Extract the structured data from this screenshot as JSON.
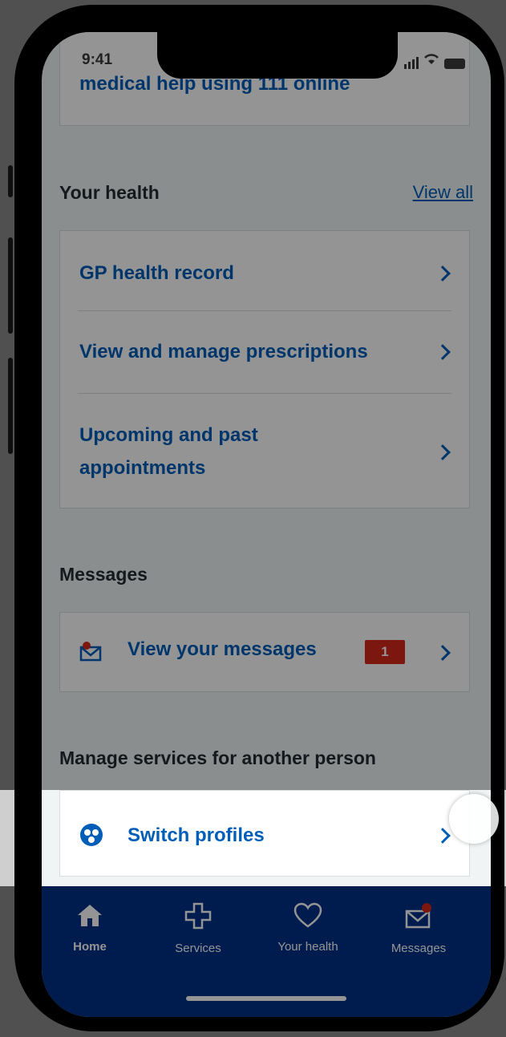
{
  "status": {
    "time": "9:41"
  },
  "partial_card": {
    "text": "medical help using 111 online"
  },
  "your_health": {
    "title": "Your health",
    "view_all": "View all",
    "items": [
      {
        "label": "GP health record"
      },
      {
        "label": "View and manage prescriptions"
      },
      {
        "label": "Upcoming and past appointments",
        "line1": "Upcoming and past",
        "line2": "appointments"
      }
    ]
  },
  "messages": {
    "title": "Messages",
    "item_label": "View your messages",
    "badge": "1"
  },
  "manage": {
    "title": "Manage services for another person",
    "item_label": "Switch profiles"
  },
  "tabs": [
    {
      "label": "Home",
      "icon": "home-icon"
    },
    {
      "label": "Services",
      "icon": "cross-icon"
    },
    {
      "label": "Your health",
      "icon": "heart-icon"
    },
    {
      "label": "Messages",
      "icon": "envelope-icon"
    }
  ],
  "colors": {
    "nhs_blue": "#005eb8",
    "nav_dark_blue": "#003087",
    "badge_red": "#d5281b"
  }
}
